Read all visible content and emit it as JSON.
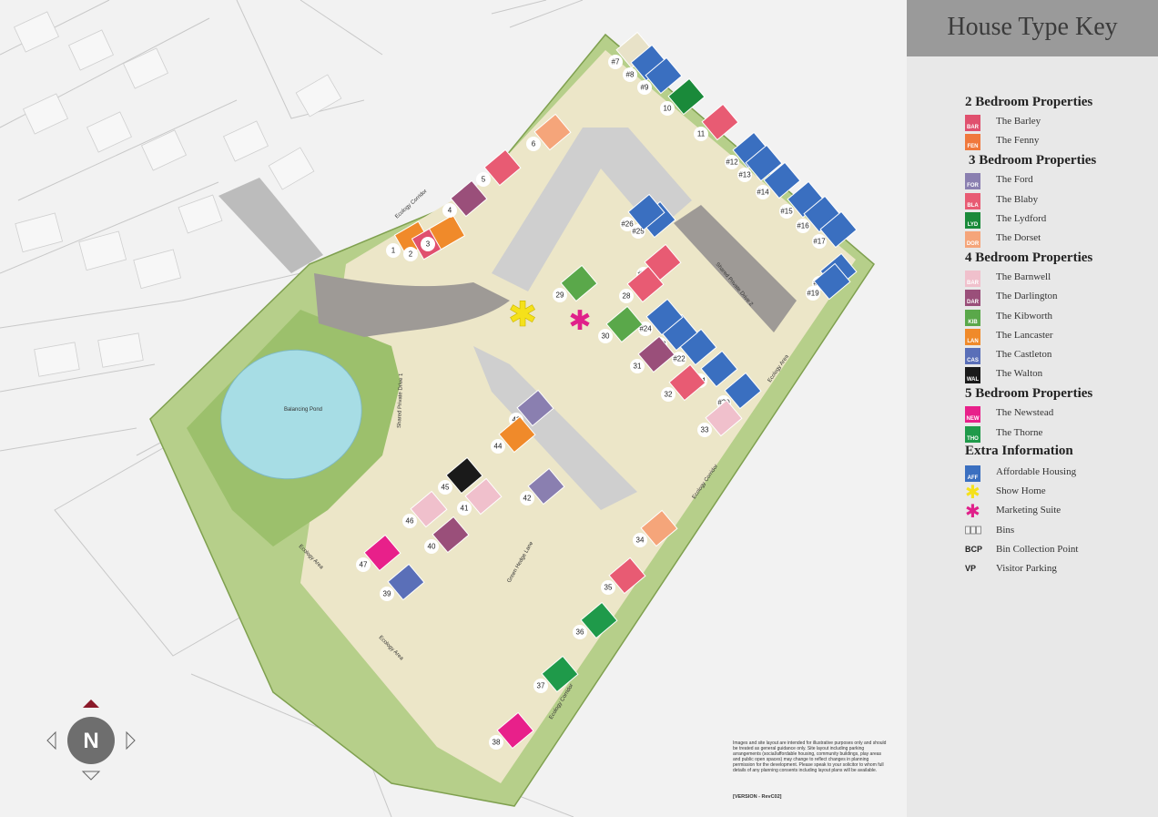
{
  "key": {
    "title": "House Type Key",
    "sections": [
      {
        "title": "2 Bedroom Properties",
        "items": [
          {
            "abbr": "BAR",
            "label": "The Barley",
            "color": "#e0506e"
          },
          {
            "abbr": "FEN",
            "label": "The Fenny",
            "color": "#f0783c"
          }
        ]
      },
      {
        "title": "3 Bedroom Properties",
        "items": [
          {
            "abbr": "FOR",
            "label": "The Ford",
            "color": "#8a7fb0"
          },
          {
            "abbr": "BLA",
            "label": "The Blaby",
            "color": "#e85b73"
          },
          {
            "abbr": "LYD",
            "label": "The Lydford",
            "color": "#1a8a3a"
          },
          {
            "abbr": "DOR",
            "label": "The Dorset",
            "color": "#f5a57a"
          }
        ]
      },
      {
        "title": "4 Bedroom Properties",
        "items": [
          {
            "abbr": "BAR",
            "label": "The Barnwell",
            "color": "#f0c0cc"
          },
          {
            "abbr": "DAR",
            "label": "The Darlington",
            "color": "#9a4f7a"
          },
          {
            "abbr": "KIB",
            "label": "The Kibworth",
            "color": "#5aa84a"
          },
          {
            "abbr": "LAN",
            "label": "The Lancaster",
            "color": "#f08a2a"
          },
          {
            "abbr": "CAS",
            "label": "The Castleton",
            "color": "#5a6fb8"
          },
          {
            "abbr": "WAL",
            "label": "The Walton",
            "color": "#1a1a1a"
          }
        ]
      },
      {
        "title": "5 Bedroom Properties",
        "items": [
          {
            "abbr": "NEW",
            "label": "The Newstead",
            "color": "#e8208a"
          },
          {
            "abbr": "THO",
            "label": "The Thorne",
            "color": "#1f9a4a"
          }
        ]
      }
    ],
    "extra_title": "Extra Information",
    "extra": [
      {
        "symbol": "swatch",
        "abbr": "AFF",
        "label": "Affordable Housing",
        "color": "#3a6fc0"
      },
      {
        "symbol": "star-yellow",
        "label": "Show Home",
        "color": "#f5e11a"
      },
      {
        "symbol": "star-pink",
        "label": "Marketing Suite",
        "color": "#e0208a"
      },
      {
        "symbol": "bins",
        "label": "Bins"
      },
      {
        "symbol": "text",
        "abbr": "BCP",
        "label": "Bin Collection Point"
      },
      {
        "symbol": "text",
        "abbr": "VP",
        "label": "Visitor Parking"
      }
    ]
  },
  "map": {
    "labels": {
      "pond": "Balancing Pond",
      "ecology_corridor": "Ecology Corridor",
      "ecology_area": "Ecology Area",
      "shared_drive_1": "Shared Private Drive 1",
      "shared_drive_2": "Shared Private Drive 2",
      "green_hedge_lane": "Green Hedge Lane"
    },
    "compass_letter": "N",
    "plots": [
      {
        "n": "1",
        "hex": "#f08a2a"
      },
      {
        "n": "2",
        "hex": "#e0506e"
      },
      {
        "n": "3",
        "hex": "#f08a2a"
      },
      {
        "n": "4",
        "hex": "#9a4f7a"
      },
      {
        "n": "5",
        "hex": "#e85b73"
      },
      {
        "n": "6",
        "hex": "#f5a57a"
      },
      {
        "n": "#7",
        "hex": "#e8e2c8"
      },
      {
        "n": "#8",
        "hex": "#3a6fc0"
      },
      {
        "n": "#9",
        "hex": "#3a6fc0"
      },
      {
        "n": "10",
        "hex": "#1a8a3a"
      },
      {
        "n": "11",
        "hex": "#e85b73"
      },
      {
        "n": "#12",
        "hex": "#3a6fc0"
      },
      {
        "n": "#13",
        "hex": "#3a6fc0"
      },
      {
        "n": "#14",
        "hex": "#3a6fc0"
      },
      {
        "n": "#15",
        "hex": "#3a6fc0"
      },
      {
        "n": "#16",
        "hex": "#3a6fc0"
      },
      {
        "n": "#17",
        "hex": "#3a6fc0"
      },
      {
        "n": "#18",
        "hex": "#3a6fc0"
      },
      {
        "n": "#19",
        "hex": "#3a6fc0"
      },
      {
        "n": "#20",
        "hex": "#3a6fc0"
      },
      {
        "n": "#21",
        "hex": "#3a6fc0"
      },
      {
        "n": "#22",
        "hex": "#3a6fc0"
      },
      {
        "n": "#23",
        "hex": "#3a6fc0"
      },
      {
        "n": "#24",
        "hex": "#3a6fc0"
      },
      {
        "n": "#25",
        "hex": "#3a6fc0"
      },
      {
        "n": "#26",
        "hex": "#3a6fc0"
      },
      {
        "n": "#27",
        "hex": "#e85b73"
      },
      {
        "n": "28",
        "hex": "#e85b73"
      },
      {
        "n": "29",
        "hex": "#5aa84a"
      },
      {
        "n": "30",
        "hex": "#5aa84a"
      },
      {
        "n": "31",
        "hex": "#9a4f7a"
      },
      {
        "n": "32",
        "hex": "#e85b73"
      },
      {
        "n": "33",
        "hex": "#f0c0cc"
      },
      {
        "n": "34",
        "hex": "#f5a57a"
      },
      {
        "n": "35",
        "hex": "#e85b73"
      },
      {
        "n": "36",
        "hex": "#1f9a4a"
      },
      {
        "n": "37",
        "hex": "#1f9a4a"
      },
      {
        "n": "38",
        "hex": "#e8208a"
      },
      {
        "n": "39",
        "hex": "#5a6fb8"
      },
      {
        "n": "40",
        "hex": "#9a4f7a"
      },
      {
        "n": "41",
        "hex": "#f0c0cc"
      },
      {
        "n": "42",
        "hex": "#8a7fb0"
      },
      {
        "n": "43",
        "hex": "#8a7fb0"
      },
      {
        "n": "44",
        "hex": "#f08a2a"
      },
      {
        "n": "45",
        "hex": "#1a1a1a"
      },
      {
        "n": "46",
        "hex": "#f0c0cc"
      },
      {
        "n": "47",
        "hex": "#e8208a"
      }
    ]
  },
  "disclaimer": "Images and site layout are intended for illustrative purposes only and should be treated as general guidance only. Site layout including parking arrangements (social/affordable housing, community buildings, play areas and public open spaces) may change to reflect changes in planning permission for the development. Please speak to your solicitor to whom full details of any planning consents including layout plans will be available.",
  "version": "[VERSION - RevC02]"
}
